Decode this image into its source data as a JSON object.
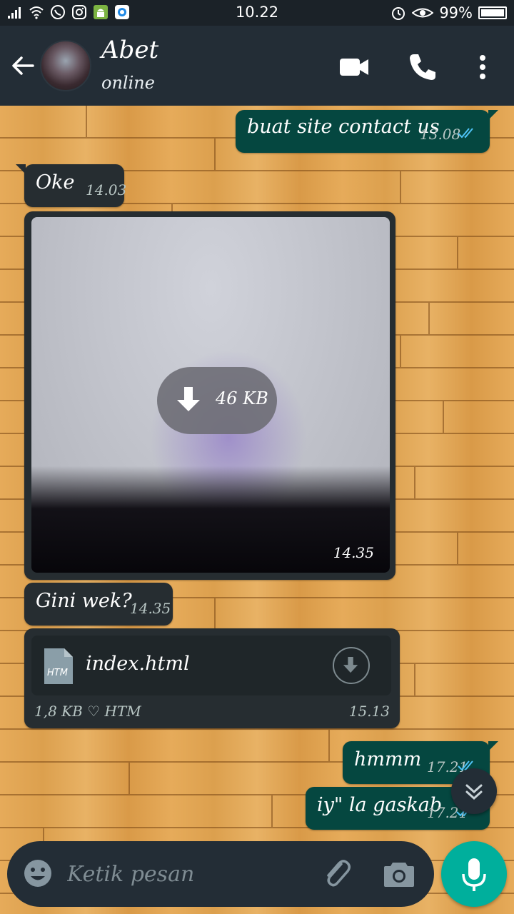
{
  "status_bar": {
    "time": "10.22",
    "battery": "99%",
    "battery_level": 0.99
  },
  "header": {
    "contact_name": "Abet",
    "contact_status": "online"
  },
  "messages": [
    {
      "direction": "out",
      "text": "buat site contact us",
      "time": "13.08",
      "read": true
    },
    {
      "direction": "in",
      "text": "Oke",
      "time": "14.03"
    },
    {
      "direction": "in",
      "type": "image",
      "download_size": "46 KB",
      "time": "14.35"
    },
    {
      "direction": "in",
      "text": "Gini wek?",
      "time": "14.35"
    },
    {
      "direction": "in",
      "type": "file",
      "file_name": "index.html",
      "file_icon_label": "HTM",
      "meta": "1,8 KB ♡ HTM",
      "time": "15.13"
    },
    {
      "direction": "out",
      "text": "hmmm",
      "time": "17.21",
      "read": true
    },
    {
      "direction": "out",
      "text": "iy\" la gaskab",
      "time": "17.21",
      "read": true
    }
  ],
  "input": {
    "placeholder": "Ketik pesan"
  },
  "colors": {
    "outgoing_bubble": "#054740",
    "incoming_bubble": "#262d31",
    "header": "#232d36",
    "accent": "#00af9c",
    "read_ticks": "#4fc3f7"
  },
  "icons": {
    "back": "back-arrow-icon",
    "video": "video-call-icon",
    "call": "phone-icon",
    "menu": "more-vert-icon",
    "emoji": "emoji-icon",
    "attach": "paperclip-icon",
    "camera": "camera-icon",
    "mic": "mic-icon",
    "scroll": "double-chevron-down-icon"
  }
}
